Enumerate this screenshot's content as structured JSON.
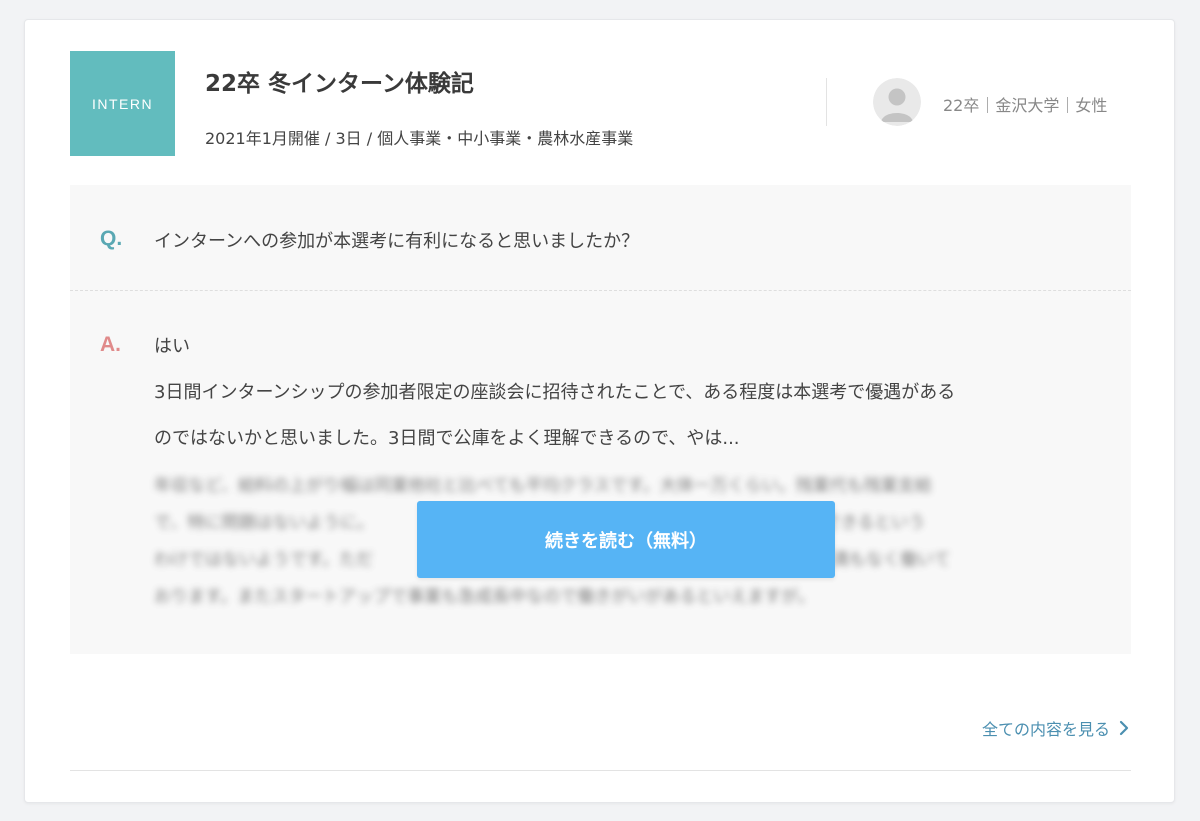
{
  "colors": {
    "badge_bg": "#62bcbe",
    "question_mark": "#5aa8b3",
    "answer_mark": "#e08a8a",
    "cta_bg": "#56b4f5",
    "link": "#4b8fb0"
  },
  "badge": {
    "label": "INTERN"
  },
  "header": {
    "title": "22卒 冬インターン体験記",
    "meta": "2021年1月開催 / 3日 / 個人事業・中小事業・農林水産事業",
    "author": "22卒｜金沢大学｜女性",
    "avatar_icon": "user-avatar-icon"
  },
  "question": {
    "mark": "Q.",
    "text": "インターンへの参加が本選考に有利になると思いましたか？"
  },
  "answer": {
    "mark": "A.",
    "short": "はい",
    "lines": [
      "3日間インターンシップの参加者限定の座談会に招待されたことで、ある程度は本選考で優遇がある",
      "のではないかと思いました。3日間で公庫をよく理解できるので、やは..."
    ],
    "blurred_lines": [
      "年収など、給料の上がり幅は同業他社と比べても平均クラスです。大体一万くらい。残業代も残業支給",
      "で、特に問題はないように。　　　　　　　　　　　　　　　　　　　　　ペースで昇給できるという",
      "わけではないようです。ただ　　　　　　　　　　　　　　　　　　　　　なので特に不満もなく働いて",
      "おります。またスタートアップで事業も急成長中なので働きがいがあるといえますが。"
    ]
  },
  "cta": {
    "label": "続きを読む（無料）"
  },
  "footer": {
    "link_label": "全ての内容を見る",
    "link_icon": "chevron-right-icon"
  }
}
